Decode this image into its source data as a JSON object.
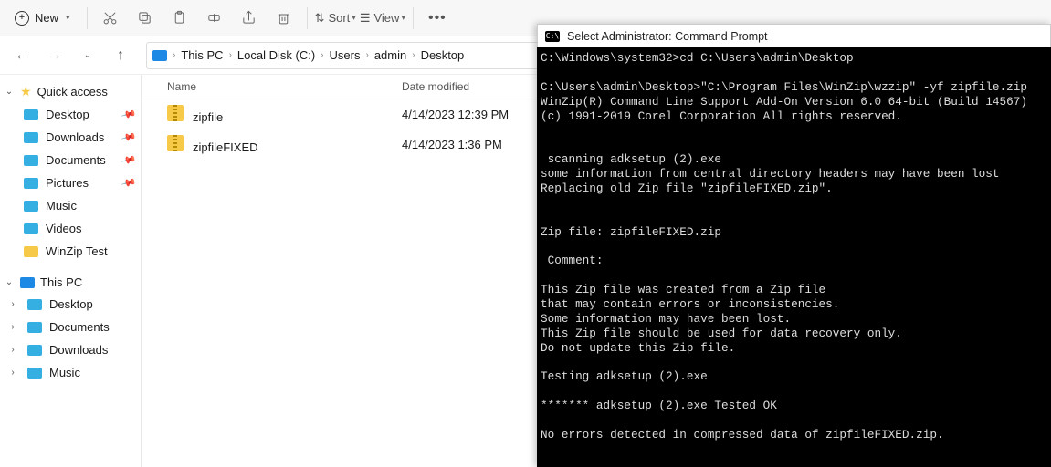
{
  "toolbar": {
    "new_label": "New",
    "sort_label": "Sort",
    "view_label": "View"
  },
  "breadcrumbs": {
    "root_icon": "pc",
    "items": [
      "This PC",
      "Local Disk (C:)",
      "Users",
      "admin",
      "Desktop"
    ]
  },
  "sidebar": {
    "quick_access_label": "Quick access",
    "quick_items": [
      {
        "label": "Desktop",
        "pinned": true
      },
      {
        "label": "Downloads",
        "pinned": true
      },
      {
        "label": "Documents",
        "pinned": true
      },
      {
        "label": "Pictures",
        "pinned": true
      },
      {
        "label": "Music",
        "pinned": false
      },
      {
        "label": "Videos",
        "pinned": false
      },
      {
        "label": "WinZip Test",
        "pinned": false,
        "yellow": true
      }
    ],
    "this_pc_label": "This PC",
    "pc_items": [
      {
        "label": "Desktop"
      },
      {
        "label": "Documents"
      },
      {
        "label": "Downloads"
      },
      {
        "label": "Music"
      }
    ]
  },
  "filelist": {
    "columns": {
      "name": "Name",
      "date": "Date modified"
    },
    "rows": [
      {
        "name": "zipfile",
        "date": "4/14/2023 12:39 PM"
      },
      {
        "name": "zipfileFIXED",
        "date": "4/14/2023 1:36 PM"
      }
    ]
  },
  "cmd": {
    "title": "Select Administrator: Command Prompt",
    "body": "C:\\Windows\\system32>cd C:\\Users\\admin\\Desktop\n\nC:\\Users\\admin\\Desktop>\"C:\\Program Files\\WinZip\\wzzip\" -yf zipfile.zip\nWinZip(R) Command Line Support Add-On Version 6.0 64-bit (Build 14567)\n(c) 1991-2019 Corel Corporation All rights reserved.\n\n\n scanning adksetup (2).exe\nsome information from central directory headers may have been lost\nReplacing old Zip file \"zipfileFIXED.zip\".\n\n\nZip file: zipfileFIXED.zip\n\n Comment:\n\nThis Zip file was created from a Zip file\nthat may contain errors or inconsistencies.\nSome information may have been lost.\nThis Zip file should be used for data recovery only.\nDo not update this Zip file.\n\nTesting adksetup (2).exe\n\n******* adksetup (2).exe Tested OK\n\nNo errors detected in compressed data of zipfileFIXED.zip."
  }
}
